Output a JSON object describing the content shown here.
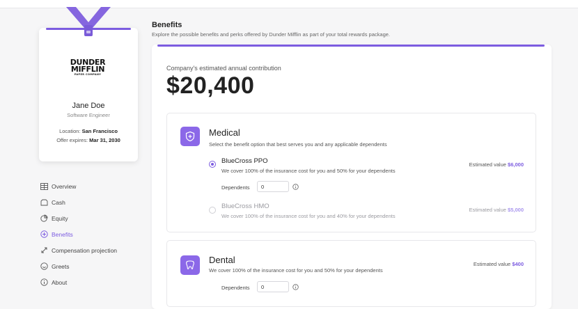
{
  "badge": {
    "logo_line1": "DUNDER",
    "logo_line2": "MIFFLIN",
    "logo_sub": "PAPER COMPANY",
    "name": "Jane Doe",
    "title": "Software Engineer",
    "location_label": "Location:",
    "location_value": "San Francisco",
    "expires_label": "Offer expires:",
    "expires_value": "Mar 31, 2030",
    "accent_color": "#7c5ce0"
  },
  "nav": {
    "items": [
      {
        "label": "Overview",
        "icon": "table-icon"
      },
      {
        "label": "Cash",
        "icon": "wallet-icon"
      },
      {
        "label": "Equity",
        "icon": "pie-chart-icon"
      },
      {
        "label": "Benefits",
        "icon": "plus-circle-icon",
        "active": true
      },
      {
        "label": "Compensation projection",
        "icon": "expand-arrows-icon"
      },
      {
        "label": "Greets",
        "icon": "smile-icon"
      },
      {
        "label": "About",
        "icon": "info-icon"
      }
    ]
  },
  "header": {
    "title": "Benefits",
    "subtitle": "Explore the possible benefits and perks offered by Dunder Mifflin as part of your total rewards package."
  },
  "contribution": {
    "label": "Company's estimated annual contribution",
    "value": "$20,400"
  },
  "medical": {
    "icon": "shield-plus-icon",
    "title": "Medical",
    "description": "Select the benefit option that best serves you and any applicable dependents",
    "options": [
      {
        "name": "BlueCross PPO",
        "description": "We cover 100% of the insurance cost for you and 50% for your dependents",
        "est_label": "Estimated value",
        "est_value": "$6,000",
        "selected": true,
        "dependents_label": "Dependents",
        "dependents_value": "0"
      },
      {
        "name": "BlueCross HMO",
        "description": "We cover 100% of the insurance cost for you and 40% for your dependents",
        "est_label": "Estimated value",
        "est_value": "$5,000",
        "selected": false
      }
    ]
  },
  "dental": {
    "icon": "tooth-icon",
    "title": "Dental",
    "description": "We cover 100% of the insurance cost for you and 50% for your dependents",
    "est_label": "Estimated value",
    "est_value": "$400",
    "dependents_label": "Dependents",
    "dependents_value": "0"
  },
  "colors": {
    "accent": "#7c5ce0",
    "icon_bg": "#8b68e8"
  }
}
